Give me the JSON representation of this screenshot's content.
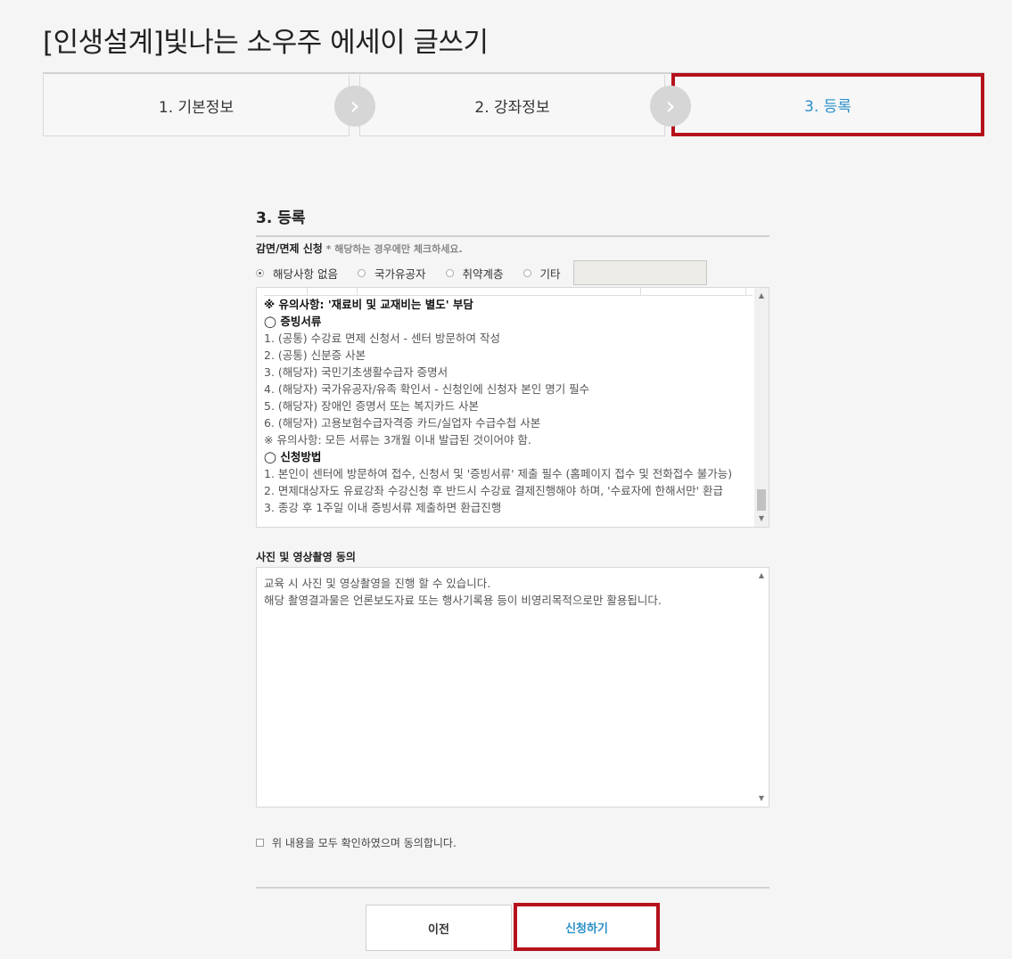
{
  "page": {
    "title": "[인생설계]빛나는 소우주 에세이 글쓰기"
  },
  "steps": [
    {
      "label": "1. 기본정보"
    },
    {
      "label": "2. 강좌정보"
    },
    {
      "label": "3. 등록"
    }
  ],
  "step_arrow_icon": "chevron-right-icon",
  "section": {
    "heading": "3. 등록"
  },
  "discount": {
    "label": "감면/면제 신청",
    "hint": " * 해당하는 경우에만 체크하세요.",
    "options": [
      {
        "label": "해당사항 없음",
        "checked": true
      },
      {
        "label": "국가유공자",
        "checked": false
      },
      {
        "label": "취약계층",
        "checked": false
      },
      {
        "label": "기타",
        "checked": false
      }
    ],
    "other_value": "",
    "notice_lines": [
      {
        "text": "※ 유의사항: '재료비 및 교재비는 별도' 부담",
        "bold": true
      },
      {
        "text": "◯ 증빙서류",
        "bold": true
      },
      {
        "text": "1. (공통) 수강료 면제 신청서 - 센터 방문하여 작성",
        "bold": false
      },
      {
        "text": "2. (공통) 신분증 사본",
        "bold": false
      },
      {
        "text": "3. (해당자) 국민기초생활수급자 증명서",
        "bold": false
      },
      {
        "text": "4. (해당자) 국가유공자/유족 확인서 - 신청인에 신청자 본인 명기 필수",
        "bold": false
      },
      {
        "text": "5. (해당자) 장애인 증명서 또는 복지카드 사본",
        "bold": false
      },
      {
        "text": "6. (해당자) 고용보험수급자격증 카드/실업자 수급수첩 사본",
        "bold": false
      },
      {
        "text": "※ 유의사항: 모든 서류는 3개월 이내 발급된 것이어야 함.",
        "bold": false
      },
      {
        "text": "◯ 신청방법",
        "bold": true
      },
      {
        "text": "1. 본인이 센터에 방문하여 접수, 신청서 및 '증빙서류' 제출 필수 (홈페이지 접수 및 전화접수 불가능)",
        "bold": false
      },
      {
        "text": "2. 면제대상자도 유료강좌 수강신청 후 반드시 수강료 결제진행해야 하며, '수료자에 한해서만' 환급",
        "bold": false
      },
      {
        "text": "3. 종강 후 1주일 이내 증빙서류 제출하면 환급진행",
        "bold": false
      }
    ]
  },
  "photo_consent": {
    "label": "사진 및 영상촬영 동의",
    "text": "교육 시 사진 및 영상촬영을 진행 할 수 있습니다.\n해당 촬영결과물은 언론보도자료 또는 행사기록용 등이 비영리목적으로만 활용됩니다."
  },
  "agree": {
    "label": "위 내용을 모두 확인하였으며 동의합니다.",
    "checked": false
  },
  "buttons": {
    "prev": "이전",
    "submit": "신청하기"
  },
  "colors": {
    "accent": "#2a8fc9",
    "highlight": "#b5121b"
  }
}
